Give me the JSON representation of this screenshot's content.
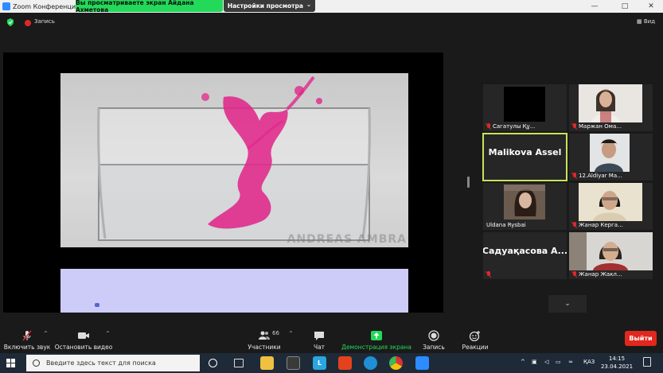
{
  "window": {
    "title": "Zoom Конференция",
    "minimize_glyph": "—",
    "maximize_glyph": "□",
    "close_glyph": "✕"
  },
  "share_banner": {
    "text": "Вы просматриваете экран Айдана Ахметова",
    "view_options_label": "Настройки просмотра",
    "view_options_caret": "⌄"
  },
  "meeting_header": {
    "recording_label": "Запись",
    "view_label": "Вид"
  },
  "shared_screen": {
    "watermark": "ANDREAS AMBRA"
  },
  "participants": [
    {
      "name": "Сагатулы Құ...",
      "muted": true,
      "video": "dark"
    },
    {
      "name": "Маржан Ома...",
      "muted": true,
      "video": "photo"
    },
    {
      "name": "Malikova Assel",
      "display_name": "Malikova Assel",
      "muted": false,
      "active_speaker": true,
      "video": "off"
    },
    {
      "name": "12.Aldiyar Ma...",
      "muted": true,
      "video": "photo"
    },
    {
      "name": "Uldana Rysbai",
      "muted": false,
      "video": "photo"
    },
    {
      "name": "Жанар Керга...",
      "muted": true,
      "video": "photo"
    },
    {
      "name": "",
      "display_name": "Садуақасова А...",
      "muted": true,
      "video": "off"
    },
    {
      "name": "Жанар Жакл...",
      "muted": true,
      "video": "photo"
    }
  ],
  "gallery_more": "⌄",
  "toolbar": {
    "unmute_label": "Включить звук",
    "start_video_label": "Остановить видео",
    "participants_label": "Участники",
    "participants_count": "66",
    "chat_label": "Чат",
    "share_screen_label": "Демонстрация экрана",
    "record_label": "Запись",
    "reactions_label": "Реакции",
    "leave_label": "Выйти",
    "caret": "^"
  },
  "taskbar": {
    "search_placeholder": "Введите здесь текст для поиска",
    "language": "ҚАЗ",
    "time": "14:15",
    "date": "23.04.2021",
    "apps": [
      "task-view",
      "file-explorer",
      "store",
      "l-app",
      "office",
      "edge",
      "chrome",
      "zoom"
    ]
  },
  "colors": {
    "accent_green": "#23d959",
    "leave_red": "#e0281e",
    "active_border": "#c7e35a",
    "taskbar": "#1f2a38"
  }
}
